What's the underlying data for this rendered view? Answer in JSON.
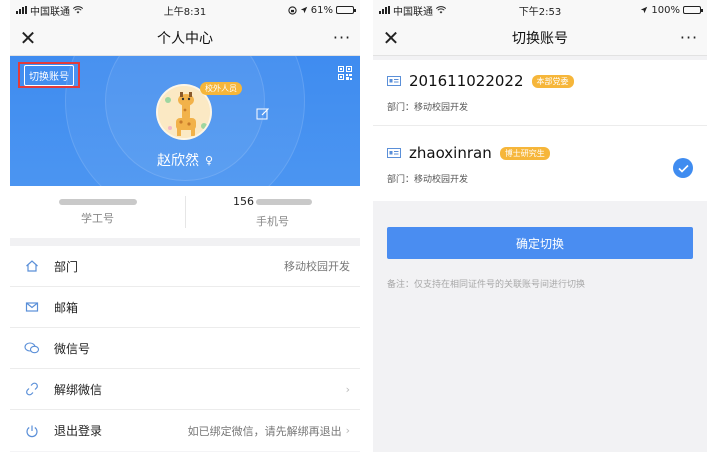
{
  "left": {
    "status": {
      "carrier": "中国联通",
      "time": "上午8:31",
      "battery": "61%",
      "battery_level": 0.61
    },
    "nav": {
      "close": "✕",
      "title": "个人中心",
      "more": "···"
    },
    "profile": {
      "switch_account_label": "切换账号",
      "badge": "校外人员",
      "name": "赵欣然",
      "gender_icon": "♀"
    },
    "info": [
      {
        "value_prefix": "",
        "label": "学工号"
      },
      {
        "value_prefix": "156",
        "label": "手机号"
      }
    ],
    "menu": [
      {
        "icon": "home-icon",
        "label": "部门",
        "value": "移动校园开发",
        "chevron": ""
      },
      {
        "icon": "mail-icon",
        "label": "邮箱",
        "value": "",
        "chevron": ""
      },
      {
        "icon": "wechat-icon",
        "label": "微信号",
        "value": "",
        "chevron": ""
      },
      {
        "icon": "unlink-icon",
        "label": "解绑微信",
        "value": "",
        "chevron": "›"
      },
      {
        "icon": "power-icon",
        "label": "退出登录",
        "value": "如已绑定微信，请先解绑再退出",
        "chevron": "›"
      }
    ]
  },
  "right": {
    "status": {
      "carrier": "中国联通",
      "time": "下午2:53",
      "battery": "100%",
      "battery_level": 1.0
    },
    "nav": {
      "close": "✕",
      "title": "切换账号",
      "more": "···"
    },
    "accounts": [
      {
        "id": "201611022022",
        "tag": "本部党委",
        "dept": "部门：移动校园开发",
        "selected": false
      },
      {
        "id": "zhaoxinran",
        "tag": "博士研究生",
        "dept": "部门：移动校园开发",
        "selected": true
      }
    ],
    "confirm_label": "确定切换",
    "note": "备注：仅支持在相同证件号的关联账号间进行切换"
  },
  "colors": {
    "brand_blue": "#3f8cf0",
    "tag_orange": "#f6b63a",
    "highlight_red": "#e23b3b"
  }
}
